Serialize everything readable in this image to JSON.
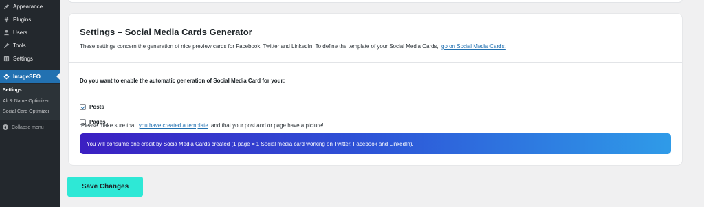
{
  "sidebar": {
    "items": [
      {
        "label": "Appearance",
        "icon": "paintbrush-icon"
      },
      {
        "label": "Plugins",
        "icon": "plug-icon"
      },
      {
        "label": "Users",
        "icon": "users-icon"
      },
      {
        "label": "Tools",
        "icon": "wrench-icon"
      },
      {
        "label": "Settings",
        "icon": "settings-icon"
      },
      {
        "label": "ImageSEO",
        "icon": "imageseo-icon"
      }
    ],
    "submenu": [
      "Settings",
      "Alt & Name Optimizer",
      "Social Card Optimizer"
    ],
    "collapse_label": "Collapse menu"
  },
  "card": {
    "title": "Settings – Social Media Cards Generator",
    "description": "These settings concern the generation of nice preview cards for Facebook, Twitter and LinkedIn. To define the template of your Social Media Cards,",
    "description_link": "go on Social Media Cards.",
    "question": "Do you want to enable the automatic generation of Social Media Card for your:",
    "options": [
      {
        "label": "Posts",
        "checked": true
      },
      {
        "label": "Pages",
        "checked": false
      }
    ],
    "note_before": "Please make sure that",
    "note_link": "you have created a template",
    "note_after": "and that your post and or page have a picture!",
    "banner": "You will consume one credit by Socia Media Cards created (1 page = 1 Social media card working on Twitter, Facebook and LinkedIn)."
  },
  "save_label": "Save Changes",
  "colors": {
    "sidebar_bg": "#23282d",
    "active_item": "#2271b1",
    "save_button": "#2ee8d6",
    "banner_start": "#3b1fc2",
    "banner_end": "#2f9be8",
    "link": "#2271b1"
  }
}
